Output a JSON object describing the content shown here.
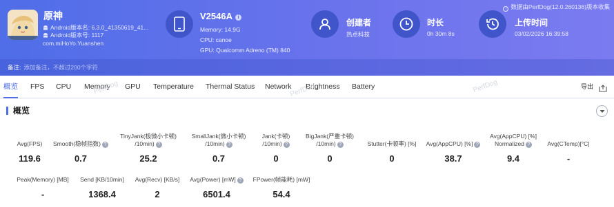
{
  "app": {
    "name": "原神",
    "android_version": "Android版本名: 6.3.0_41350619_41...",
    "android_build": "Android版本号: 1117",
    "package": "com.miHoYo.Yuanshen"
  },
  "device": {
    "name": "V2546A",
    "memory": "Memory: 14.9G",
    "cpu": "CPU: canoe",
    "gpu": "GPU: Qualcomm Adreno (TM) 840"
  },
  "creator": {
    "title": "创建者",
    "value": "热点科技"
  },
  "duration": {
    "title": "时长",
    "value": "0h 30m 8s"
  },
  "upload": {
    "title": "上传时间",
    "value": "03/02/2026 16:39:58"
  },
  "data_source": "数据由PerfDog(12.0.260136)版本收集",
  "remark": {
    "label": "备注:",
    "placeholder": "添加备注，不超过200个字符"
  },
  "tabs": [
    "概览",
    "FPS",
    "CPU",
    "Memory",
    "GPU",
    "Temperature",
    "Thermal Status",
    "Network",
    "Brightness",
    "Battery"
  ],
  "export_label": "导出",
  "watermark": "PerfDog",
  "section_title": "概览",
  "metrics_row1": [
    {
      "label1": "Avg(FPS)",
      "label2": "",
      "help": false,
      "value": "119.6"
    },
    {
      "label1": "Smooth(稳帧指数)",
      "label2": "",
      "help": true,
      "value": "0.7"
    },
    {
      "label1": "TinyJank(极微小卡顿)",
      "label2": "/10min)",
      "help": true,
      "value": "25.2"
    },
    {
      "label1": "SmallJank(微小卡顿)",
      "label2": "/10min)",
      "help": true,
      "value": "0.7"
    },
    {
      "label1": "Jank(卡顿)",
      "label2": "/10min)",
      "help": true,
      "value": "0"
    },
    {
      "label1": "BigJank(严重卡顿)",
      "label2": "/10min)",
      "help": true,
      "value": "0"
    },
    {
      "label1": "Stutter(卡顿率) [%]",
      "label2": "",
      "help": false,
      "value": "0"
    },
    {
      "label1": "Avg(AppCPU) [%]",
      "label2": "",
      "help": true,
      "value": "38.7"
    },
    {
      "label1": "Avg(AppCPU) [%]",
      "label2": "Normalized",
      "help": true,
      "value": "9.4"
    },
    {
      "label1": "Avg(CTemp)[°C]",
      "label2": "",
      "help": false,
      "value": "-"
    }
  ],
  "metrics_row2": [
    {
      "label": "Peak(Memory) [MB]",
      "help": false,
      "value": "-"
    },
    {
      "label": "Send [KB/10min]",
      "help": false,
      "value": "1368.4"
    },
    {
      "label": "Avg(Recv) [KB/s]",
      "help": false,
      "value": "2"
    },
    {
      "label": "Avg(Power) [mW]",
      "help": true,
      "value": "6501.4"
    },
    {
      "label": "FPower(帧能耗) [mW]",
      "help": false,
      "value": "54.4"
    }
  ],
  "colors": {
    "header_start": "#4f6ee8",
    "header_end": "#7b7bf0",
    "accent": "#4f6ee8",
    "icon_circle": "#3f55c9"
  },
  "icons": [
    "game-avatar",
    "android-icon",
    "info-icon",
    "phone-icon",
    "user-icon",
    "clock-icon",
    "history-icon",
    "export-icon",
    "chevron-down-icon",
    "help-icon"
  ]
}
